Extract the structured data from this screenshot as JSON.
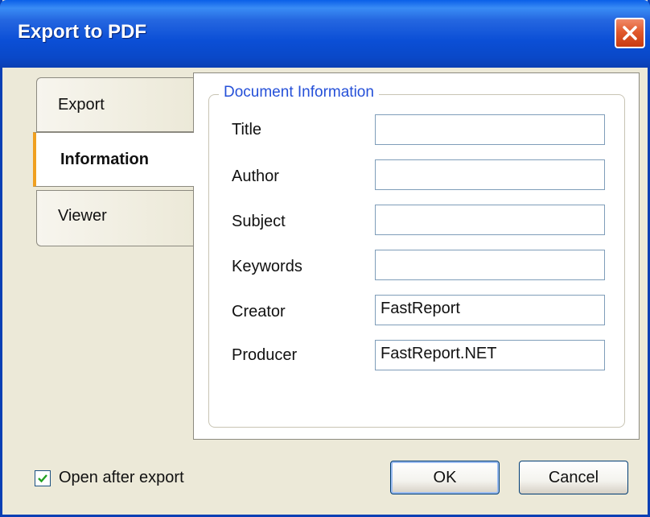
{
  "window": {
    "title": "Export to PDF"
  },
  "tabs": [
    {
      "label": "Export",
      "selected": false
    },
    {
      "label": "Information",
      "selected": true
    },
    {
      "label": "Viewer",
      "selected": false
    }
  ],
  "group": {
    "legend": "Document Information"
  },
  "fields": [
    {
      "label": "Title",
      "value": ""
    },
    {
      "label": "Author",
      "value": ""
    },
    {
      "label": "Subject",
      "value": ""
    },
    {
      "label": "Keywords",
      "value": ""
    },
    {
      "label": "Creator",
      "value": "FastReport"
    },
    {
      "label": "Producer",
      "value": "FastReport.NET"
    }
  ],
  "footer": {
    "open_after_export_label": "Open after export",
    "open_after_export_checked": true,
    "ok_label": "OK",
    "cancel_label": "Cancel"
  },
  "colors": {
    "titlebar": "#0a48c8",
    "selected_tab_marker": "#f0a020",
    "group_legend": "#2550d8",
    "close_button": "#e15a2e"
  },
  "icons": {
    "close": "close-icon",
    "check": "checkmark-icon"
  }
}
